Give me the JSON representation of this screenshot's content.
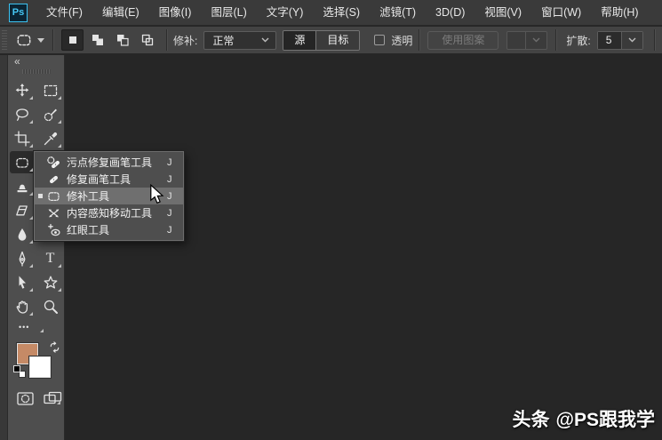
{
  "app": {
    "logo_text": "Ps",
    "logo_accent_color": "#3cc1f0"
  },
  "menubar": {
    "items": [
      "文件(F)",
      "编辑(E)",
      "图像(I)",
      "图层(L)",
      "文字(Y)",
      "选择(S)",
      "滤镜(T)",
      "3D(D)",
      "视图(V)",
      "窗口(W)",
      "帮助(H)"
    ]
  },
  "options_bar": {
    "active_tool_icon": "patch-tool-icon",
    "selection_modes": [
      "new-selection",
      "add-to-selection",
      "subtract-from-selection",
      "intersect-selection"
    ],
    "selected_mode": "new-selection",
    "patch_label": "修补:",
    "patch_mode_value": "正常",
    "source_button": "源",
    "destination_button": "目标",
    "active_side": "源",
    "transparent_label": "透明",
    "transparent_checked": false,
    "use_pattern_button": "使用图案",
    "use_pattern_enabled": false,
    "pattern_picker_enabled": false,
    "diffusion_label": "扩散:",
    "diffusion_value": "5"
  },
  "tool_panel": {
    "collapse_glyph": "«",
    "tools": [
      "move",
      "rectangular-marquee",
      "lasso",
      "quick-selection",
      "crop",
      "eyedropper",
      "patch",
      "clone-stamp",
      "eraser",
      "blur",
      "pen",
      "horizontal-type",
      "path-selection",
      "custom-shape",
      "hand",
      "zoom",
      "edit-toolbar"
    ],
    "selected_tool": "patch",
    "type_tool_glyph": "T",
    "more_glyph": "•••",
    "foreground_color": "#c58a66",
    "background_color": "#ffffff"
  },
  "flyout_menu": {
    "items": [
      {
        "icon": "spot-healing-brush-icon",
        "label": "污点修复画笔工具",
        "shortcut": "J",
        "selected": false
      },
      {
        "icon": "healing-brush-icon",
        "label": "修复画笔工具",
        "shortcut": "J",
        "selected": false
      },
      {
        "icon": "patch-tool-icon",
        "label": "修补工具",
        "shortcut": "J",
        "selected": true
      },
      {
        "icon": "content-aware-move-icon",
        "label": "内容感知移动工具",
        "shortcut": "J",
        "selected": false
      },
      {
        "icon": "red-eye-icon",
        "label": "红眼工具",
        "shortcut": "J",
        "selected": false
      }
    ]
  },
  "watermark": {
    "brand": "头条",
    "handle": "@PS跟我学"
  },
  "canvas": {
    "background": "#262626"
  }
}
